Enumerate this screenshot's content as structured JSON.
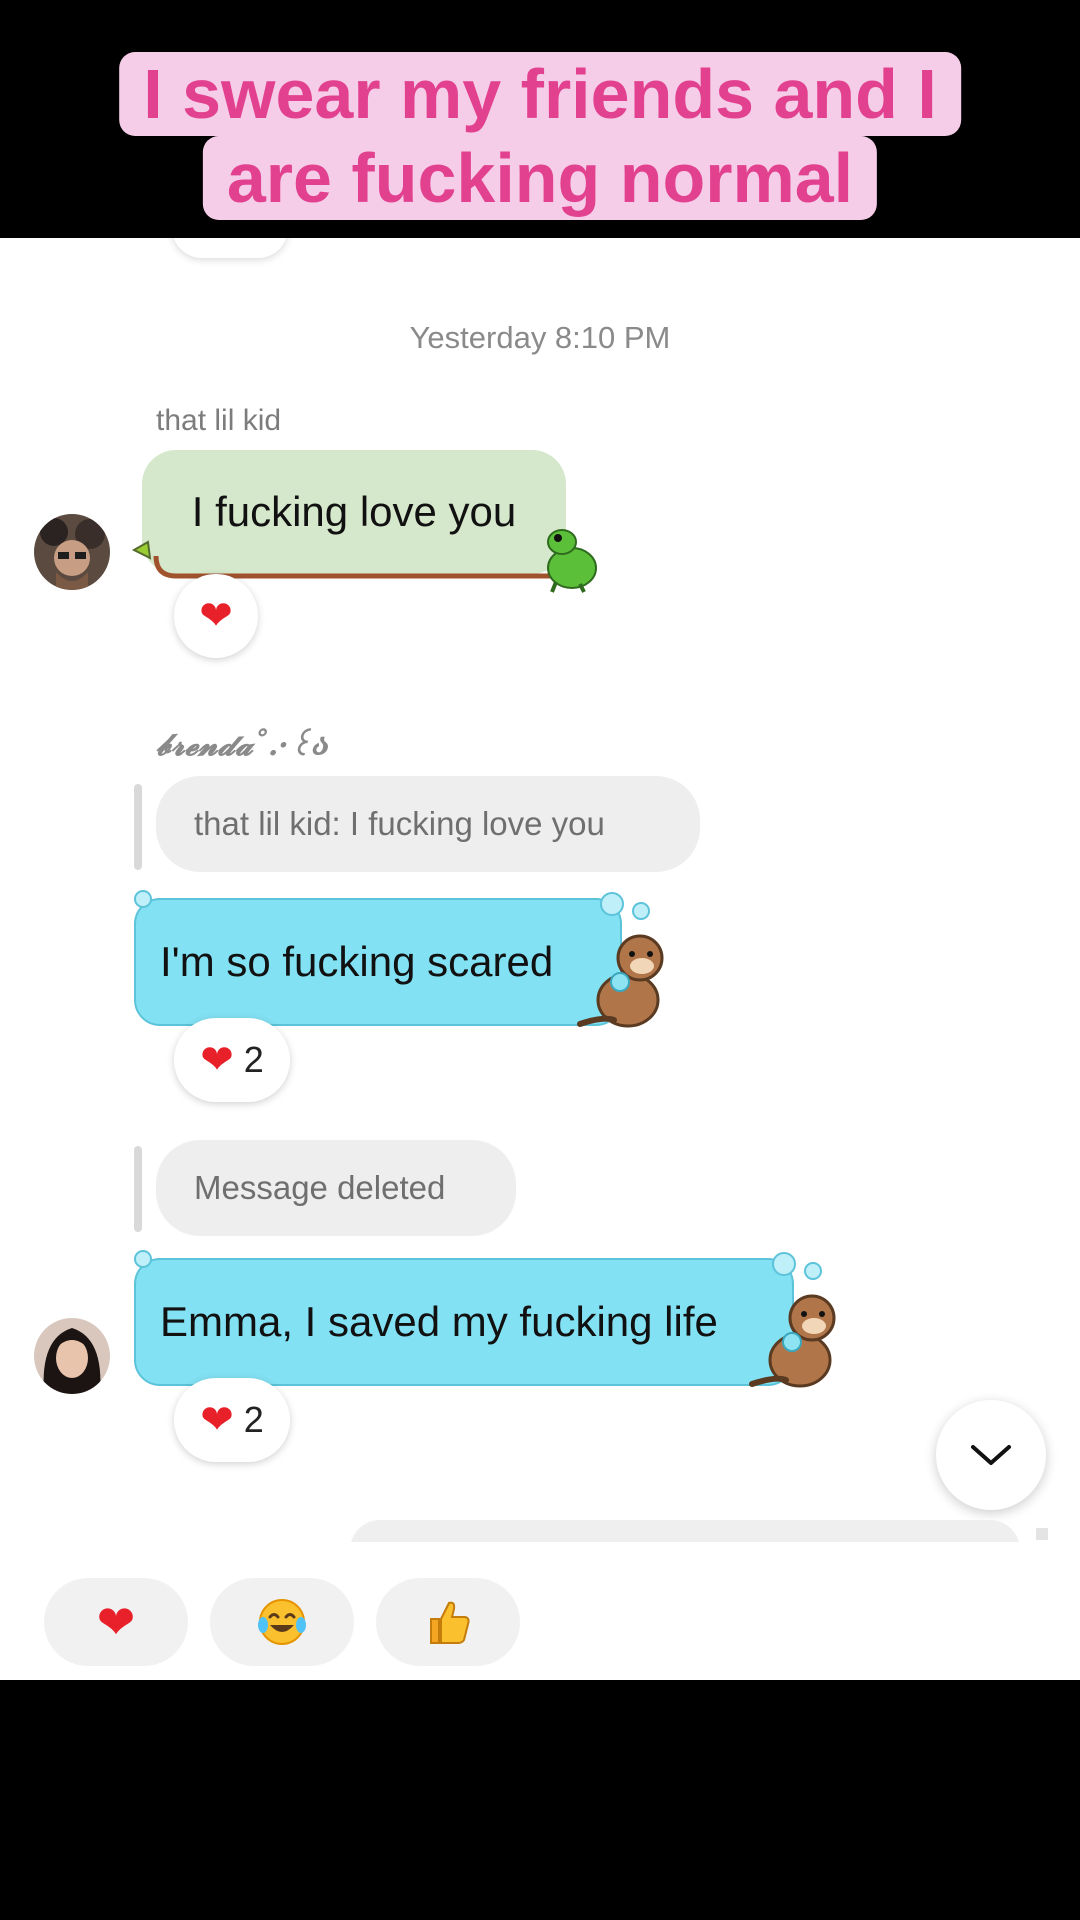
{
  "caption": {
    "line1": "I swear my friends and I",
    "line2": "are fucking normal"
  },
  "chat": {
    "timestamp": "Yesterday 8:10 PM",
    "messages": [
      {
        "sender": "that lil kid",
        "text": "I fucking love you",
        "reaction": {
          "emoji": "heart",
          "count": ""
        }
      },
      {
        "sender": "𝓫𝓻𝓮𝓷𝓭𝓪˚.·꒰ა",
        "reply_to": "that lil kid: I fucking love you",
        "text": "I'm so fucking scared",
        "reaction": {
          "emoji": "heart",
          "count": "2"
        }
      },
      {
        "reply_to": "Message deleted",
        "text": "Emma, I saved my fucking life",
        "reaction": {
          "emoji": "heart",
          "count": "2"
        }
      }
    ]
  },
  "quick_reactions": [
    {
      "emoji": "heart"
    },
    {
      "emoji": "face-with-tears-of-joy"
    },
    {
      "emoji": "thumbs-up"
    }
  ],
  "colors": {
    "caption_bg": "#f6cde8",
    "caption_text": "#e2418f",
    "green_bubble": "#d6e8cc",
    "blue_bubble": "#82e1f3",
    "heart": "#e8202a"
  }
}
